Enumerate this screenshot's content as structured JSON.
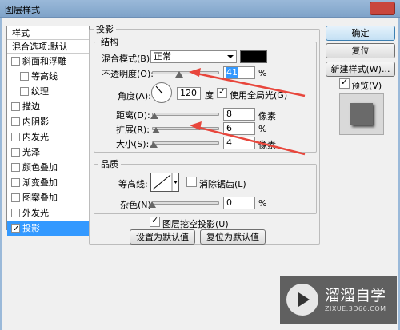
{
  "window": {
    "title": "图层样式"
  },
  "styles_list": {
    "header": "样式",
    "blend": "混合选项:默认",
    "items": [
      {
        "label": "斜面和浮雕",
        "checked": false,
        "indent": false
      },
      {
        "label": "等高线",
        "checked": false,
        "indent": true
      },
      {
        "label": "纹理",
        "checked": false,
        "indent": true
      },
      {
        "label": "描边",
        "checked": false,
        "indent": false
      },
      {
        "label": "内阴影",
        "checked": false,
        "indent": false
      },
      {
        "label": "内发光",
        "checked": false,
        "indent": false
      },
      {
        "label": "光泽",
        "checked": false,
        "indent": false
      },
      {
        "label": "颜色叠加",
        "checked": false,
        "indent": false
      },
      {
        "label": "渐变叠加",
        "checked": false,
        "indent": false
      },
      {
        "label": "图案叠加",
        "checked": false,
        "indent": false
      },
      {
        "label": "外发光",
        "checked": false,
        "indent": false
      },
      {
        "label": "投影",
        "checked": true,
        "indent": false
      }
    ]
  },
  "shadow": {
    "title": "投影",
    "structure": {
      "title": "结构",
      "blend_mode_label": "混合模式(B):",
      "blend_mode_value": "正常",
      "opacity_label": "不透明度(O):",
      "opacity_value": "41",
      "opacity_level": 0.41,
      "percent": "%",
      "angle_label": "角度(A):",
      "angle_value": "120",
      "angle_unit": "度",
      "global_light_label": "使用全局光(G)",
      "global_light_checked": true,
      "distance_label": "距离(D):",
      "distance_value": "8",
      "distance_level": 0.03,
      "spread_label": "扩展(R):",
      "spread_value": "6",
      "spread_level": 0.06,
      "size_label": "大小(S):",
      "size_value": "4",
      "size_level": 0.02,
      "pixel": "像素"
    },
    "quality": {
      "title": "品质",
      "contour_label": "等高线:",
      "antialias_label": "消除锯齿(L)",
      "antialias_checked": false,
      "noise_label": "杂色(N):",
      "noise_value": "0",
      "noise_level": 0,
      "percent": "%"
    },
    "knockout_label": "图层挖空投影(U)",
    "knockout_checked": true,
    "set_default": "设置为默认值",
    "reset_default": "复位为默认值"
  },
  "buttons": {
    "ok": "确定",
    "reset": "复位",
    "new_style": "新建样式(W)...",
    "preview_label": "预览(V)",
    "preview_checked": true
  },
  "watermark": {
    "title": "溜溜自学",
    "subtitle": "ZIXUE.3D66.COM"
  },
  "colors": {
    "arrow": "#e8463c",
    "selection": "#3399ff",
    "shadow_color": "#000000"
  }
}
